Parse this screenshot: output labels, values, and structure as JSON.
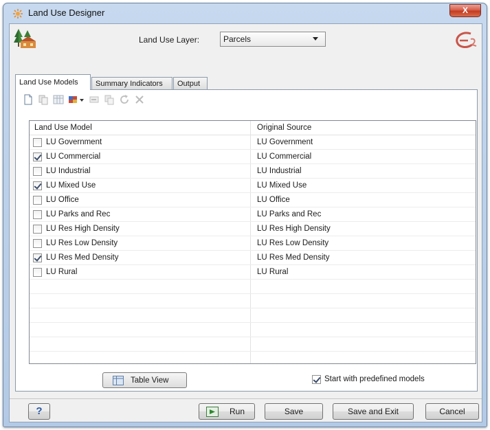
{
  "window": {
    "title": "Land Use Designer",
    "close_glyph": "X"
  },
  "header": {
    "layer_label": "Land Use Layer:",
    "layer_value": "Parcels"
  },
  "tabs": [
    {
      "label": "Land Use Models",
      "active": true
    },
    {
      "label": "Summary Indicators",
      "active": false
    },
    {
      "label": "Output",
      "active": false
    }
  ],
  "toolbar": [
    {
      "icon": "new-document-icon"
    },
    {
      "icon": "copy-icon"
    },
    {
      "icon": "table-icon"
    },
    {
      "icon": "color-palette-dropdown-icon"
    },
    {
      "icon": "rename-icon"
    },
    {
      "icon": "duplicate-icon"
    },
    {
      "icon": "refresh-icon"
    },
    {
      "icon": "delete-icon"
    }
  ],
  "grid": {
    "columns": [
      "Land Use Model",
      "Original Source"
    ],
    "rows": [
      {
        "model": "LU Government",
        "source": "LU Government",
        "checked": false
      },
      {
        "model": "LU Commercial",
        "source": "LU Commercial",
        "checked": true
      },
      {
        "model": "LU Industrial",
        "source": "LU Industrial",
        "checked": false
      },
      {
        "model": "LU Mixed Use",
        "source": "LU Mixed Use",
        "checked": true
      },
      {
        "model": "LU Office",
        "source": "LU Office",
        "checked": false
      },
      {
        "model": "LU Parks and Rec",
        "source": "LU Parks and Rec",
        "checked": false
      },
      {
        "model": "LU Res High Density",
        "source": "LU Res High Density",
        "checked": false
      },
      {
        "model": "LU Res Low Density",
        "source": "LU Res Low Density",
        "checked": false
      },
      {
        "model": "LU Res Med Density",
        "source": "LU Res Med Density",
        "checked": true
      },
      {
        "model": "LU Rural",
        "source": "LU Rural",
        "checked": false
      }
    ]
  },
  "options": {
    "table_view_label": "Table View",
    "predefined_label": "Start with predefined models",
    "predefined_checked": true
  },
  "buttons": {
    "help": "?",
    "run": "Run",
    "save": "Save",
    "save_exit": "Save and Exit",
    "cancel": "Cancel"
  },
  "colors": {
    "title_bar": "#bcd1ea",
    "close_button": "#c1391f",
    "client_bg": "#f0f0f0"
  }
}
